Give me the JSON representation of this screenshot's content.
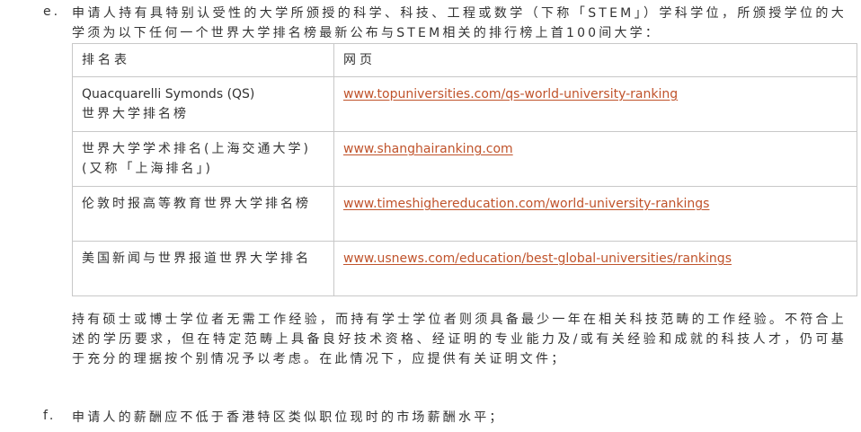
{
  "item_e": {
    "marker": "e.",
    "text": "申请人持有具特别认受性的大学所颁授的科学、科技、工程或数学（下称「STEM」）学科学位，所颁授学位的大学须为以下任何一个世界大学排名榜最新公布与STEM相关的排行榜上首100间大学："
  },
  "table": {
    "headers": [
      "排名表",
      "网页"
    ],
    "rows": [
      {
        "name_en": "Quacquarelli Symonds (QS)",
        "name": "世界大学排名榜",
        "url": "www.topuniversities.com/qs-world-university-ranking"
      },
      {
        "name_en": "",
        "name": "世界大学学术排名(上海交通大学)(又称「上海排名」)",
        "url": "www.shanghairanking.com"
      },
      {
        "name_en": "",
        "name": "伦敦时报高等教育世界大学排名榜",
        "url": "www.timeshighereducation.com/world-university-rankings"
      },
      {
        "name_en": "",
        "name": "美国新闻与世界报道世界大学排名",
        "url": "www.usnews.com/education/best-global-universities/rankings"
      }
    ]
  },
  "note": "持有硕士或博士学位者无需工作经验，而持有学士学位者则须具备最少一年在相关科技范畴的工作经验。不符合上述的学历要求，但在特定范畴上具备良好技术资格、经证明的专业能力及/或有关经验和成就的科技人才，仍可基于充分的理据按个别情况予以考虑。在此情况下，应提供有关证明文件；",
  "item_f": {
    "marker": "f.",
    "text": "申请人的薪酬应不低于香港特区类似职位现时的市场薪酬水平；"
  }
}
